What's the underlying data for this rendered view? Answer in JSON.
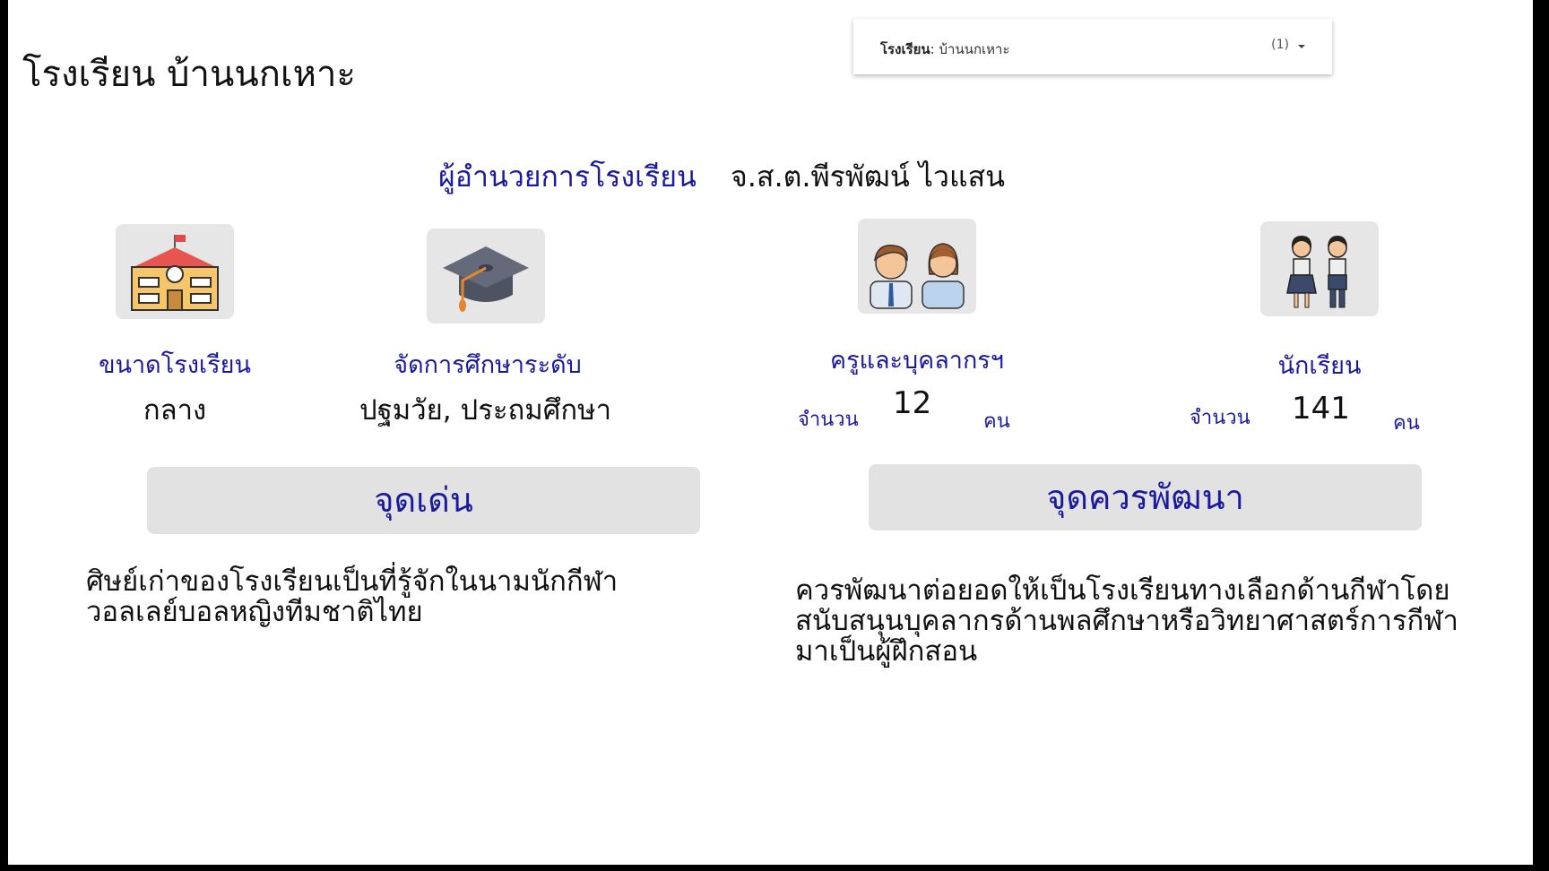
{
  "school_title": "โรงเรียน บ้านนกเหาะ",
  "filter": {
    "label": "โรงเรียน",
    "value": "บ้านนกเหาะ",
    "count": "(1)"
  },
  "director": {
    "label": "ผู้อำนวยการโรงเรียน",
    "name": "จ.ส.ต.พีรพัฒน์ ไวแสน"
  },
  "school_size": {
    "caption": "ขนาดโรงเรียน",
    "value": "กลาง"
  },
  "education_level": {
    "caption": "จัดการศึกษาระดับ",
    "value": "ปฐมวัย, ประถมศึกษา"
  },
  "staff": {
    "caption": "ครูและบุคลากรฯ",
    "count_label": "จำนวน",
    "count": "12",
    "unit": "คน"
  },
  "students": {
    "caption": "นักเรียน",
    "count_label": "จำนวน",
    "count": "141",
    "unit": "คน"
  },
  "strengths": {
    "title": "จุดเด่น",
    "text": "ศิษย์เก่าของโรงเรียนเป็นที่รู้จักในนามนักกีฬาวอลเลย์บอลหญิงทีมชาติไทย"
  },
  "improvements": {
    "title": "จุดควรพัฒนา",
    "text": "ควรพัฒนาต่อยอดให้เป็นโรงเรียนทางเลือกด้านกีฬาโดยสนับสนุนบุคลากรด้านพลศึกษาหรือวิทยาศาสตร์การกีฬามาเป็นผู้ฝึกสอน"
  },
  "icons": [
    "school-icon",
    "graduation-cap-icon",
    "teachers-icon",
    "students-icon"
  ]
}
